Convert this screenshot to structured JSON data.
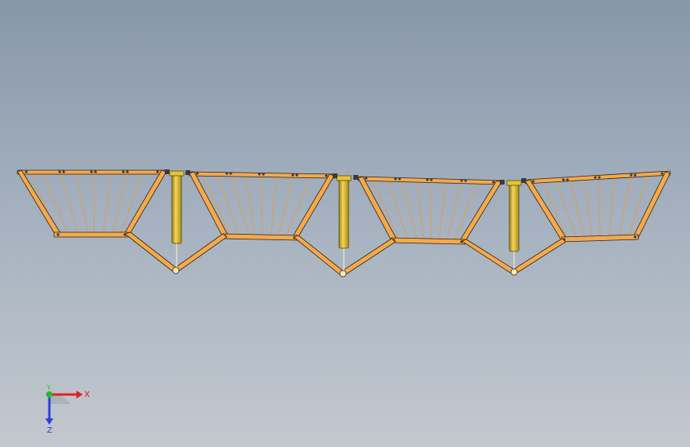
{
  "view": {
    "background_top": "#8797aa",
    "background_bottom": "#c3c8ce"
  },
  "model": {
    "beam_color": "#f5a94b",
    "beam_edge": "#2a2217",
    "cable_color": "#c9a37a",
    "cylinder_color": "#e6c23a",
    "cylinder_shade": "#a88a18",
    "modules": 4,
    "actuators": 3
  },
  "triad": {
    "x_label": "X",
    "y_label": "Y",
    "z_label": "Z",
    "x_color": "#e02020",
    "y_color": "#2db52d",
    "z_color": "#2f3fd8"
  }
}
